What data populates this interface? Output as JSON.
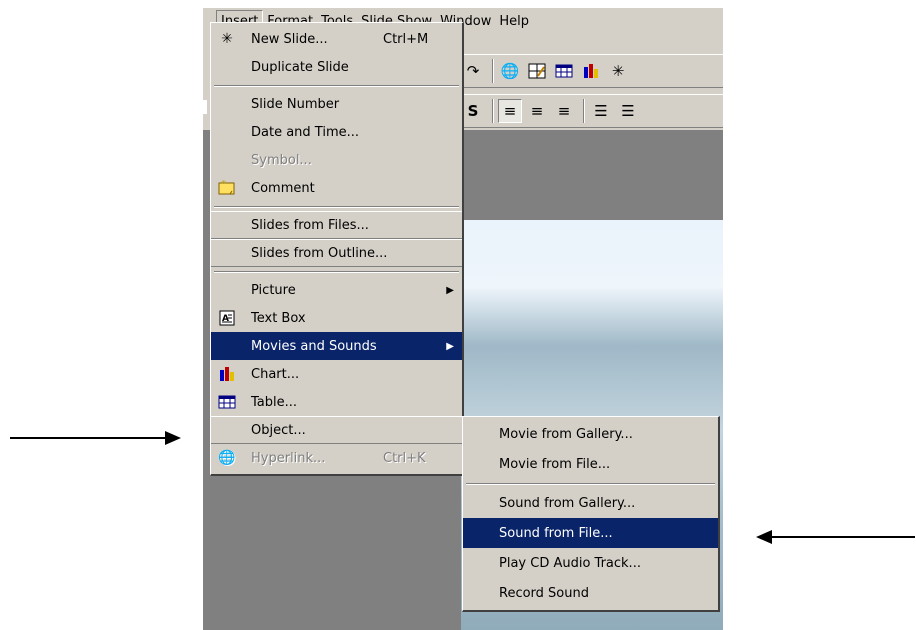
{
  "menubar": {
    "items": [
      "Insert",
      "Format",
      "Tools",
      "Slide Show",
      "Window",
      "Help"
    ]
  },
  "toolbar1": {
    "icons": [
      "redo-icon",
      "hyperlink-icon",
      "tables-borders-icon",
      "insert-table-icon",
      "insert-chart-icon",
      "new-slide-icon"
    ]
  },
  "toolbar2": {
    "icons": [
      "shadow-icon",
      "align-left-icon",
      "center-icon",
      "align-right-icon",
      "numbering-icon",
      "bullets-icon"
    ]
  },
  "insert_menu": {
    "items": [
      {
        "label": "New Slide...",
        "shortcut": "Ctrl+M",
        "icon": "new-slide-icon"
      },
      {
        "label": "Duplicate Slide"
      },
      {
        "label": "Slide Number"
      },
      {
        "label": "Date and Time..."
      },
      {
        "label": "Symbol...",
        "disabled": true
      },
      {
        "label": "Comment",
        "icon": "comment-icon"
      },
      {
        "label": "Slides from Files..."
      },
      {
        "label": "Slides from Outline..."
      },
      {
        "label": "Picture"
      },
      {
        "label": "Text Box",
        "icon": "text-box-icon"
      },
      {
        "label": "Movies and Sounds",
        "highlighted": true
      },
      {
        "label": "Chart...",
        "icon": "chart-icon"
      },
      {
        "label": "Table...",
        "icon": "table-icon"
      },
      {
        "label": "Object..."
      },
      {
        "label": "Hyperlink...",
        "shortcut": "Ctrl+K",
        "icon": "hyperlink-icon",
        "disabled": true
      }
    ]
  },
  "submenu": {
    "items": [
      {
        "label": "Movie from Gallery..."
      },
      {
        "label": "Movie from File..."
      },
      {
        "label": "Sound from Gallery..."
      },
      {
        "label": "Sound from File...",
        "highlighted": true
      },
      {
        "label": "Play CD Audio Track..."
      },
      {
        "label": "Record Sound"
      }
    ]
  },
  "colors": {
    "highlight": "#0a246a",
    "face": "#d4d0c8",
    "workspace": "#808080"
  }
}
